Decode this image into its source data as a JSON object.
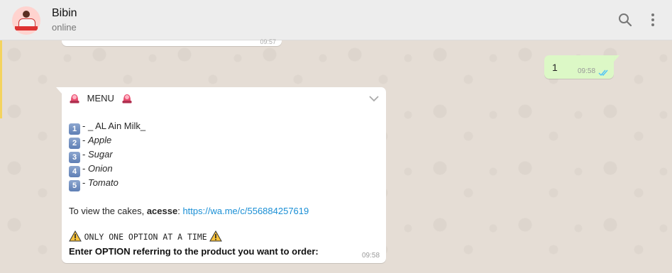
{
  "header": {
    "contact_name": "Bibin",
    "status": "online",
    "search_icon": "search-icon",
    "menu_icon": "more-vertical-icon"
  },
  "previous_message": {
    "time": "09:57"
  },
  "outgoing": {
    "text": "1",
    "time": "09:58",
    "status_icon": "double-check-icon",
    "bubble_color": "#dcf8c6"
  },
  "incoming": {
    "title": "MENU",
    "items": [
      {
        "number": "1",
        "prefix": "- ",
        "label": "_ AL Ain Milk_",
        "italic": false
      },
      {
        "number": "2",
        "prefix": "- ",
        "label": "Apple",
        "italic": true
      },
      {
        "number": "3",
        "prefix": "- ",
        "label": "Sugar",
        "italic": true
      },
      {
        "number": "4",
        "prefix": "- ",
        "label": "Onion",
        "italic": true
      },
      {
        "number": "5",
        "prefix": "- ",
        "label": "Tomato",
        "italic": true
      }
    ],
    "cakes_prefix": "To view the cakes, ",
    "cakes_bold": "acesse",
    "cakes_colon": ": ",
    "cakes_link": "https://wa.me/c/556884257619",
    "warning_text": "ONLY ONE OPTION AT A TIME",
    "instruction": "Enter OPTION referring to the product you want to order:",
    "time": "09:58",
    "link_color": "#1a8fd5"
  }
}
